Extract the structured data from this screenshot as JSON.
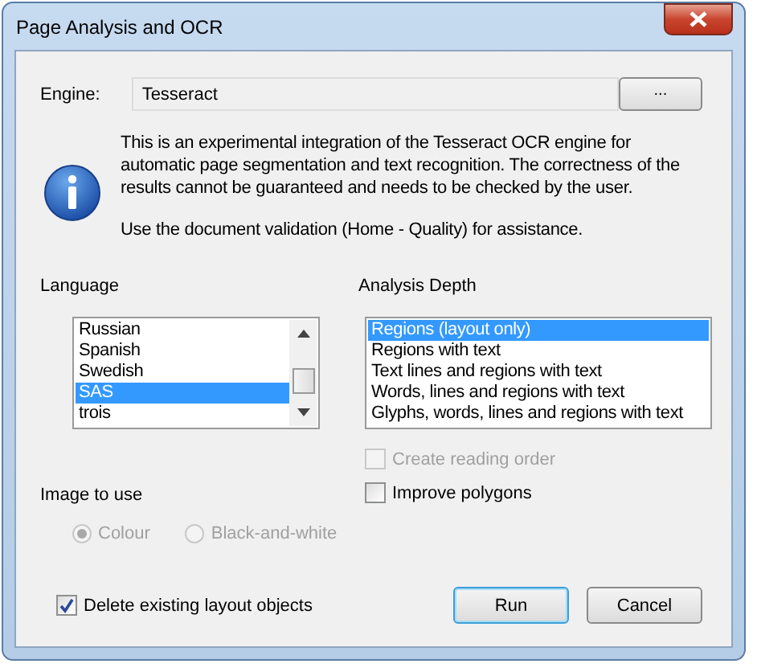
{
  "window": {
    "title": "Page Analysis and OCR"
  },
  "engine": {
    "label": "Engine:",
    "value": "Tesseract",
    "browse_button": "..."
  },
  "info": [
    "This is an experimental integration of the Tesseract OCR engine for automatic page segmentation and text recognition. The correctness of the results cannot be guaranteed and needs to be checked by the user.",
    "Use the document validation (Home - Quality) for assistance."
  ],
  "language": {
    "label": "Language",
    "items": [
      {
        "label": "Russian",
        "selected": false
      },
      {
        "label": "Spanish",
        "selected": false
      },
      {
        "label": "Swedish",
        "selected": false
      },
      {
        "label": "SAS",
        "selected": true
      },
      {
        "label": "trois",
        "selected": false
      }
    ]
  },
  "analysis_depth": {
    "label": "Analysis Depth",
    "items": [
      {
        "label": "Regions (layout only)",
        "selected": true
      },
      {
        "label": "Regions with text",
        "selected": false
      },
      {
        "label": "Text lines and regions with text",
        "selected": false
      },
      {
        "label": "Words, lines and regions with text",
        "selected": false
      },
      {
        "label": "Glyphs, words, lines and regions with text",
        "selected": false
      }
    ]
  },
  "options": [
    {
      "label": "Create reading order",
      "checked": false,
      "disabled": true
    },
    {
      "label": "Improve polygons",
      "checked": false,
      "disabled": false
    }
  ],
  "image_to_use": {
    "label": "Image to use",
    "options": [
      {
        "label": "Colour",
        "selected": true,
        "disabled": true
      },
      {
        "label": "Black-and-white",
        "selected": false,
        "disabled": true
      }
    ]
  },
  "delete_existing": {
    "label": "Delete existing layout objects",
    "checked": true
  },
  "buttons": [
    {
      "label": "Run",
      "default": true
    },
    {
      "label": "Cancel",
      "default": false
    }
  ]
}
